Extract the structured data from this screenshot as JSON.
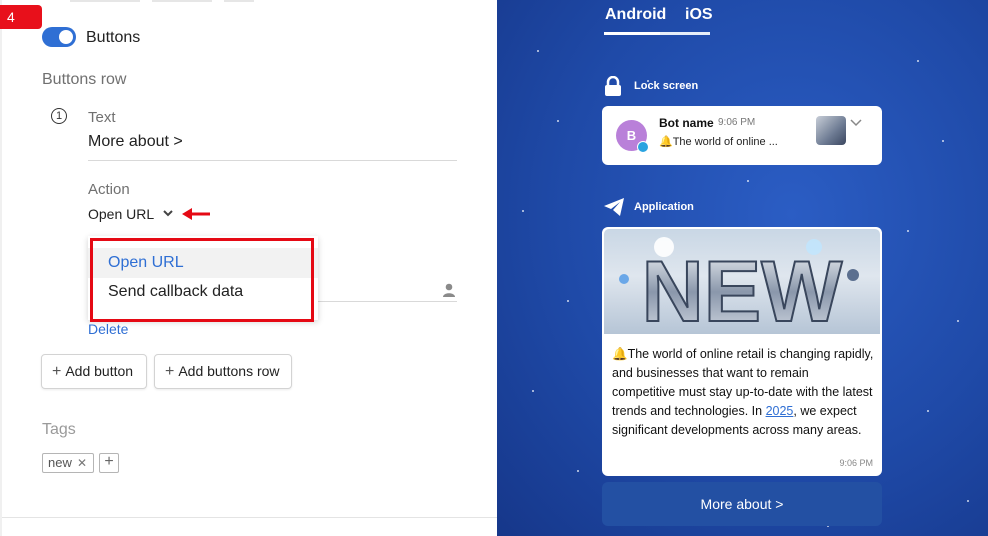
{
  "step_badge": "4",
  "toggle": {
    "label": "Buttons",
    "on": true
  },
  "buttons_row": {
    "title": "Buttons row",
    "row_number": "1",
    "text_label": "Text",
    "text_value": "More about >",
    "action_label": "Action",
    "action_value": "Open URL",
    "dropdown_options": [
      "Open URL",
      "Send callback data"
    ],
    "delete_label": "Delete"
  },
  "actions": {
    "add_button": "Add button",
    "add_buttons_row": "Add buttons row"
  },
  "tags": {
    "title": "Tags",
    "items": [
      "new"
    ]
  },
  "preview": {
    "tabs": [
      "Android",
      "iOS"
    ],
    "active_tab": "Android",
    "lock_screen_label": "Lock screen",
    "notification": {
      "avatar_letter": "B",
      "bot_name": "Bot name",
      "time": "9:06 PM",
      "text": "🔔The world of online ..."
    },
    "application_label": "Application",
    "image_word": "NEW",
    "message": {
      "text_before": "🔔The world of online retail is changing rapidly, and businesses that want to remain competitive must stay up-to-date with the latest trends and technologies. In ",
      "link_text": "2025",
      "text_after": ", we expect significant developments across many areas.",
      "time": "9:06 PM"
    },
    "button_label": "More about >"
  },
  "colors": {
    "accent": "#2f6fd4",
    "highlight_red": "#e50914",
    "preview_bg": "#1f4aa8"
  }
}
